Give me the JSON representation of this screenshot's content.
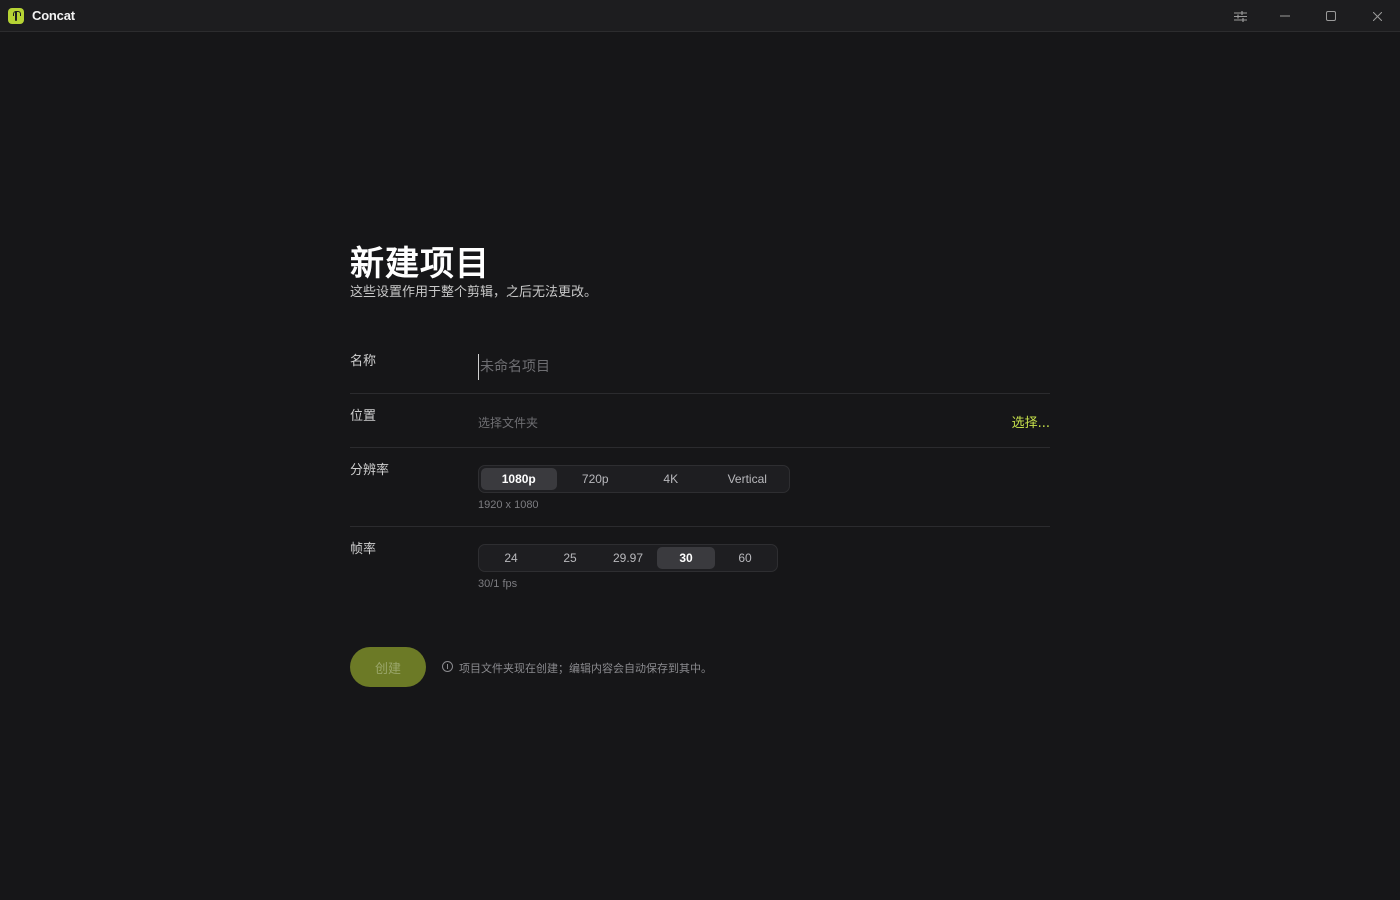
{
  "window": {
    "app_title": "Concat",
    "icons": [
      "app-logo-icon",
      "settings-sliders-icon",
      "minimize-icon",
      "maximize-icon",
      "close-icon"
    ]
  },
  "page": {
    "title": "新建项目",
    "subtitle": "这些设置作用于整个剪辑，之后无法更改。"
  },
  "form": {
    "name": {
      "label": "名称",
      "value": "",
      "placeholder": "未命名项目"
    },
    "location": {
      "label": "位置",
      "placeholder": "选择文件夹",
      "choose_label": "选择..."
    },
    "resolution": {
      "label": "分辨率",
      "options": [
        "1080p",
        "720p",
        "4K",
        "Vertical"
      ],
      "selected": "1080p",
      "hint": "1920 x 1080"
    },
    "framerate": {
      "label": "帧率",
      "options": [
        "24",
        "25",
        "29.97",
        "30",
        "60"
      ],
      "selected": "30",
      "hint": "30/1 fps"
    }
  },
  "footer": {
    "create_label": "创建",
    "info_text": "项目文件夹现在创建；编辑内容会自动保存到其中。"
  },
  "colors": {
    "accent": "#c7e24b",
    "create_button": "#6c7a26",
    "background": "#161618"
  }
}
